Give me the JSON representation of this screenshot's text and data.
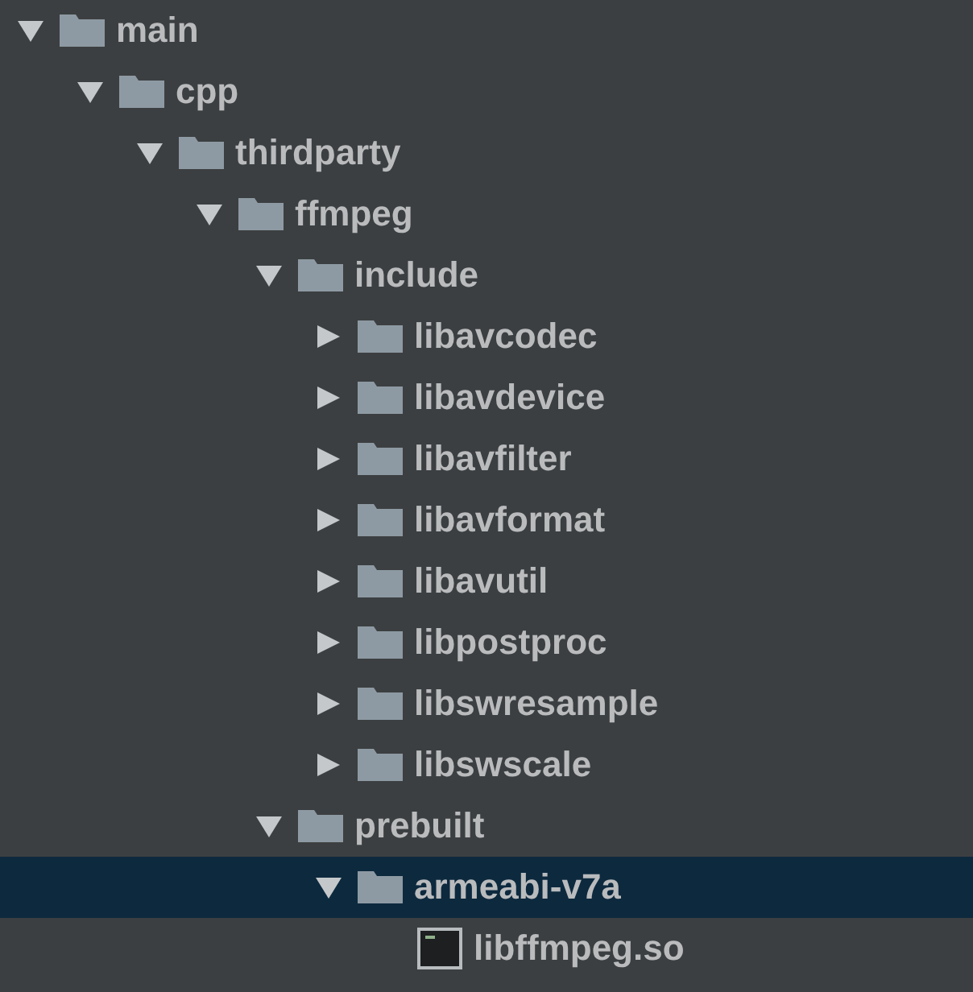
{
  "tree": [
    {
      "kind": "folder",
      "name": "main",
      "expanded": true,
      "selected": false,
      "children": [
        {
          "kind": "folder",
          "name": "cpp",
          "expanded": true,
          "selected": false,
          "children": [
            {
              "kind": "folder",
              "name": "thirdparty",
              "expanded": true,
              "selected": false,
              "children": [
                {
                  "kind": "folder",
                  "name": "ffmpeg",
                  "expanded": true,
                  "selected": false,
                  "children": [
                    {
                      "kind": "folder",
                      "name": "include",
                      "expanded": true,
                      "selected": false,
                      "children": [
                        {
                          "kind": "folder",
                          "name": "libavcodec",
                          "expanded": false,
                          "selected": false
                        },
                        {
                          "kind": "folder",
                          "name": "libavdevice",
                          "expanded": false,
                          "selected": false
                        },
                        {
                          "kind": "folder",
                          "name": "libavfilter",
                          "expanded": false,
                          "selected": false
                        },
                        {
                          "kind": "folder",
                          "name": "libavformat",
                          "expanded": false,
                          "selected": false
                        },
                        {
                          "kind": "folder",
                          "name": "libavutil",
                          "expanded": false,
                          "selected": false
                        },
                        {
                          "kind": "folder",
                          "name": "libpostproc",
                          "expanded": false,
                          "selected": false
                        },
                        {
                          "kind": "folder",
                          "name": "libswresample",
                          "expanded": false,
                          "selected": false
                        },
                        {
                          "kind": "folder",
                          "name": "libswscale",
                          "expanded": false,
                          "selected": false
                        }
                      ]
                    },
                    {
                      "kind": "folder",
                      "name": "prebuilt",
                      "expanded": true,
                      "selected": false,
                      "children": [
                        {
                          "kind": "folder",
                          "name": "armeabi-v7a",
                          "expanded": true,
                          "selected": true,
                          "children": [
                            {
                              "kind": "file",
                              "name": "libffmpeg.so",
                              "selected": false
                            }
                          ]
                        }
                      ]
                    }
                  ]
                }
              ]
            }
          ]
        }
      ]
    }
  ]
}
